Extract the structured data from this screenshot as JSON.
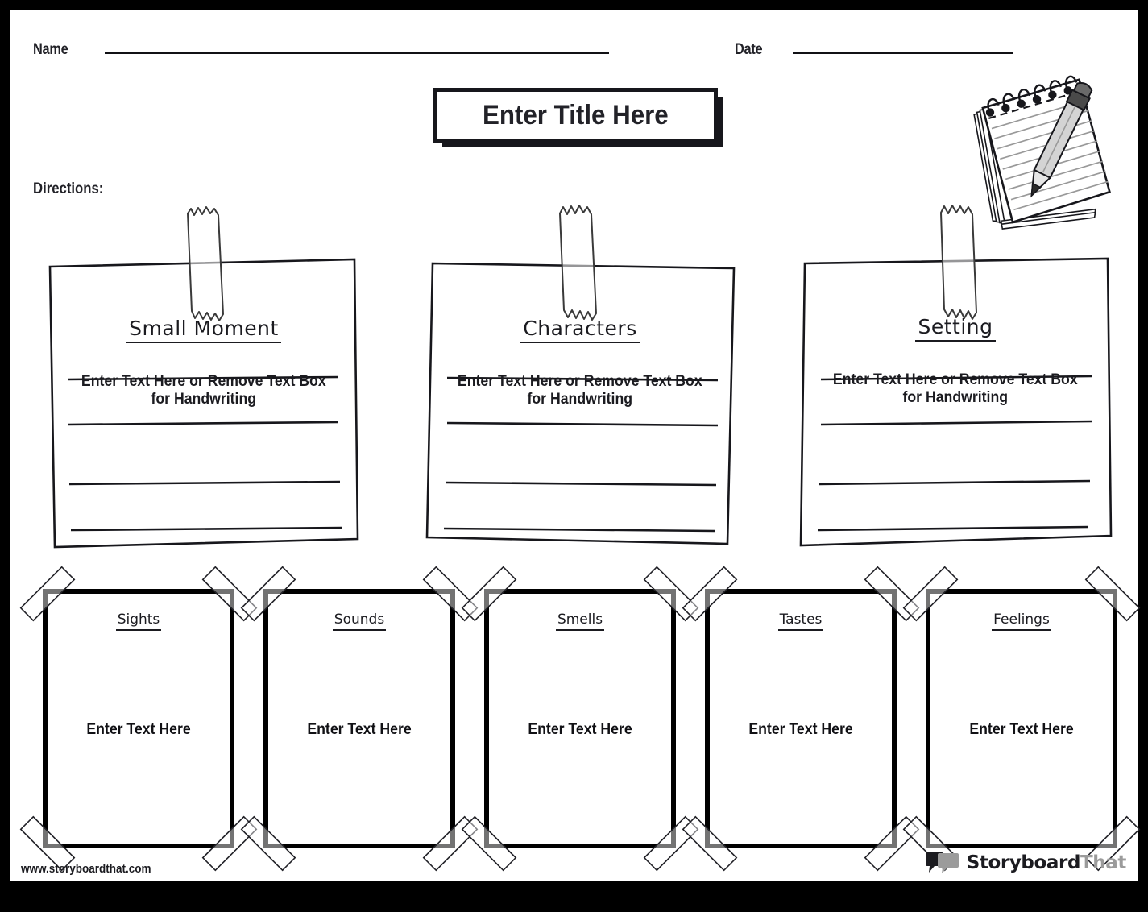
{
  "header": {
    "name_label": "Name",
    "date_label": "Date",
    "title_placeholder": "Enter Title Here",
    "directions_label": "Directions:"
  },
  "icons": {
    "notepad": "notepad-pencil-icon",
    "tape": "tape-strip-icon",
    "corner_tape": "corner-tape-icon",
    "logo": "speech-bubble-logo-icon"
  },
  "top_cards": [
    {
      "heading": "Small Moment",
      "placeholder": "Enter Text Here or Remove Text Box for Handwriting",
      "lines": 4
    },
    {
      "heading": "Characters",
      "placeholder": "Enter Text Here or Remove Text Box for Handwriting",
      "lines": 4
    },
    {
      "heading": "Setting",
      "placeholder": "Enter Text Here or Remove Text Box for Handwriting",
      "lines": 4
    }
  ],
  "sense_cards": [
    {
      "heading": "Sights",
      "placeholder": "Enter Text Here"
    },
    {
      "heading": "Sounds",
      "placeholder": "Enter Text Here"
    },
    {
      "heading": "Smells",
      "placeholder": "Enter Text Here"
    },
    {
      "heading": "Tastes",
      "placeholder": "Enter Text Here"
    },
    {
      "heading": "Feelings",
      "placeholder": "Enter Text Here"
    }
  ],
  "footer": {
    "url": "www.storyboardthat.com",
    "brand_dark": "Storyboard",
    "brand_gray": "That"
  },
  "colors": {
    "frame": "#000000",
    "page": "#ffffff",
    "ink": "#1b1b20",
    "tape_gray": "#b5b5b5",
    "logo_gray": "#9b9b9b"
  }
}
